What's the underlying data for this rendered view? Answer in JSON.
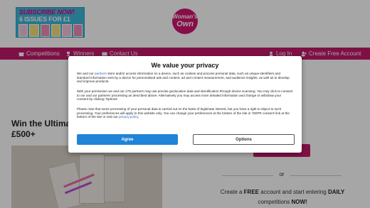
{
  "header": {
    "banner": {
      "line1": "SUBSCRIBE NOW!",
      "line2": "6 ISSUES FOR £1"
    },
    "logo": {
      "line1": "Woman's",
      "line2": "Own"
    }
  },
  "nav": {
    "competitions": "Competitions",
    "winners": "Winners",
    "contact": "Contact Us",
    "login": "Log In",
    "create_account": "Create Free Account"
  },
  "page": {
    "title": "Win the Ultima",
    "prize": "£500+",
    "right_heading": "ers",
    "or": "or",
    "cta_pre": "Create a ",
    "cta_free": "FREE",
    "cta_mid": " account and start entering ",
    "cta_daily": "DAILY",
    "cta_line2": "competitions ",
    "cta_now": "NOW!"
  },
  "consent": {
    "title": "We value your privacy",
    "p1_pre": "We and our ",
    "p1_link": "partners",
    "p1_post": " store and/or access information on a device, such as cookies and process personal data, such as unique identifiers and standard information sent by a device for personalised ads and content, ad and content measurement, and audience insights, as well as to develop and improve products.",
    "p2": "With your permission we and our 279 partners may use precise geolocation data and identification through device scanning. You may click to consent to our and our partners' processing as described above. Alternatively you may access more detailed information and change or withdraw your consent by clicking 'Options'.",
    "p3_pre": "Please note that some processing of your personal data is carried out on the basis of legitimate interest, but you have a right to object to such processing. Your preferences will apply to this website only. You can change your preferences at the bottom of the site in 'GDPR consent' link at the bottom of the site or visit our ",
    "p3_link": "privacy policy",
    "p3_post": ".",
    "agree": "Agree",
    "options": "Options"
  },
  "colors": {
    "brand": "#c41a6b",
    "agree_button": "#1f84d8",
    "link": "#2866b8"
  }
}
